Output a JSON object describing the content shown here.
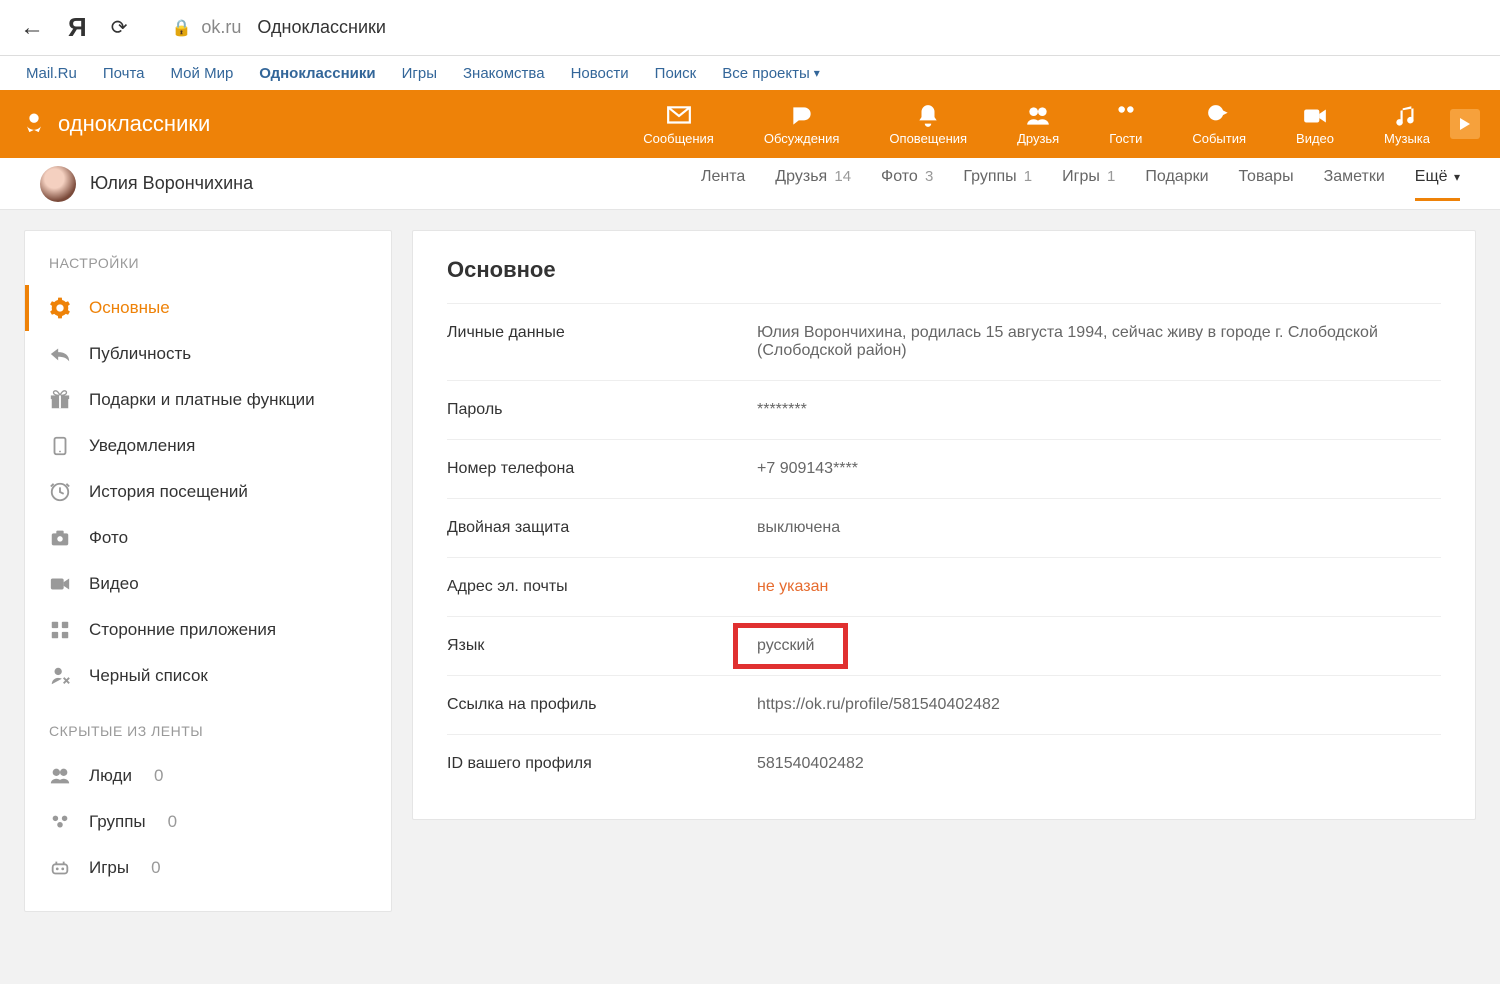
{
  "browser": {
    "domain": "ok.ru",
    "title": "Одноклассники"
  },
  "mailru_links": [
    "Mail.Ru",
    "Почта",
    "Мой Мир",
    "Одноклассники",
    "Игры",
    "Знакомства",
    "Новости",
    "Поиск",
    "Все проекты"
  ],
  "mailru_active_index": 3,
  "orange_brand": "одноклассники",
  "orange_nav": [
    {
      "label": "Сообщения"
    },
    {
      "label": "Обсуждения"
    },
    {
      "label": "Оповещения"
    },
    {
      "label": "Друзья"
    },
    {
      "label": "Гости"
    },
    {
      "label": "События"
    },
    {
      "label": "Видео"
    },
    {
      "label": "Музыка"
    }
  ],
  "profile": {
    "name": "Юлия Ворончихина",
    "tabs": [
      {
        "label": "Лента",
        "count": ""
      },
      {
        "label": "Друзья",
        "count": "14"
      },
      {
        "label": "Фото",
        "count": "3"
      },
      {
        "label": "Группы",
        "count": "1"
      },
      {
        "label": "Игры",
        "count": "1"
      },
      {
        "label": "Подарки",
        "count": ""
      },
      {
        "label": "Товары",
        "count": ""
      },
      {
        "label": "Заметки",
        "count": ""
      },
      {
        "label": "Ещё",
        "count": "",
        "more": true
      }
    ]
  },
  "sidebar": {
    "title1": "НАСТРОЙКИ",
    "items": [
      {
        "label": "Основные"
      },
      {
        "label": "Публичность"
      },
      {
        "label": "Подарки и платные функции"
      },
      {
        "label": "Уведомления"
      },
      {
        "label": "История посещений"
      },
      {
        "label": "Фото"
      },
      {
        "label": "Видео"
      },
      {
        "label": "Сторонние приложения"
      },
      {
        "label": "Черный список"
      }
    ],
    "title2": "СКРЫТЫЕ ИЗ ЛЕНТЫ",
    "hidden_items": [
      {
        "label": "Люди",
        "count": "0"
      },
      {
        "label": "Группы",
        "count": "0"
      },
      {
        "label": "Игры",
        "count": "0"
      }
    ]
  },
  "main": {
    "heading": "Основное",
    "rows": [
      {
        "label": "Личные данные",
        "value": "Юлия Ворончихина, родилась 15 августа 1994, сейчас живу в городе г. Слободской (Слободской район)"
      },
      {
        "label": "Пароль",
        "value": "********"
      },
      {
        "label": "Номер телефона",
        "value": "+7 909143****"
      },
      {
        "label": "Двойная защита",
        "value": "выключена"
      },
      {
        "label": "Адрес эл. почты",
        "value": "не указан",
        "warn": true
      },
      {
        "label": "Язык",
        "value": "русский",
        "highlight": true
      },
      {
        "label": "Ссылка на профиль",
        "value": "https://ok.ru/profile/581540402482"
      },
      {
        "label": "ID вашего профиля",
        "value": "581540402482"
      }
    ]
  }
}
